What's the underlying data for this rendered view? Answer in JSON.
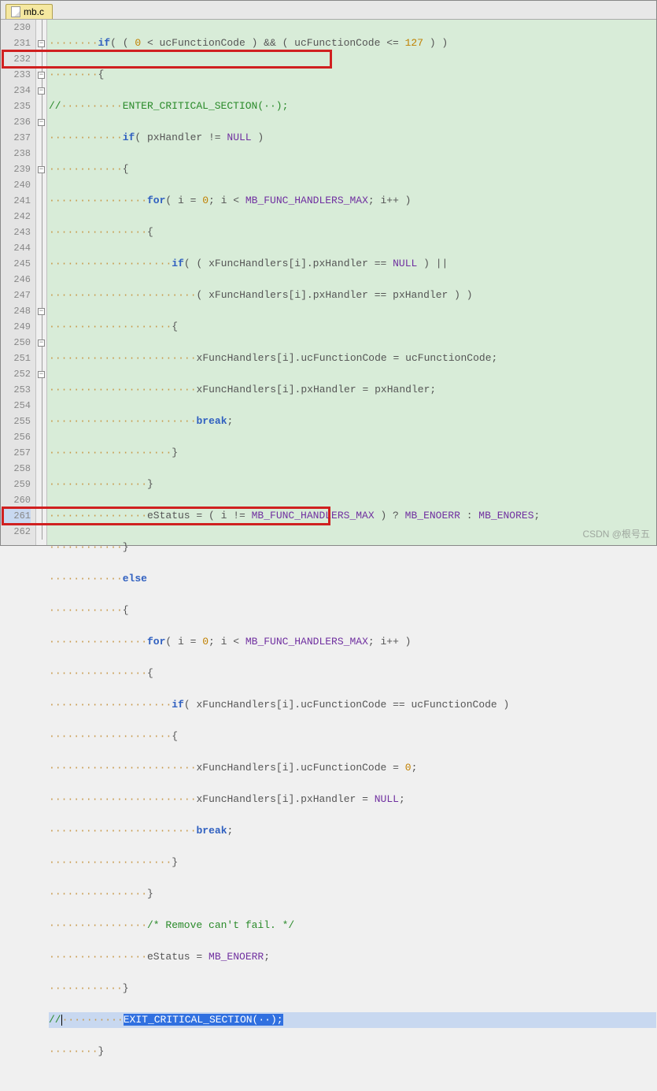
{
  "tab": {
    "filename": "mb.c"
  },
  "watermark": "CSDN @根号五",
  "fold": {
    "minus": "−",
    "rows": [
      {
        "n": 230,
        "t": "line"
      },
      {
        "n": 231,
        "t": "box"
      },
      {
        "n": 232,
        "t": "line"
      },
      {
        "n": 233,
        "t": "box"
      },
      {
        "n": 234,
        "t": "box"
      },
      {
        "n": 235,
        "t": "line"
      },
      {
        "n": 236,
        "t": "box"
      },
      {
        "n": 237,
        "t": "line"
      },
      {
        "n": 238,
        "t": "line"
      },
      {
        "n": 239,
        "t": "box"
      },
      {
        "n": 240,
        "t": "line"
      },
      {
        "n": 241,
        "t": "line"
      },
      {
        "n": 242,
        "t": "line"
      },
      {
        "n": 243,
        "t": "line"
      },
      {
        "n": 244,
        "t": "line"
      },
      {
        "n": 245,
        "t": "line"
      },
      {
        "n": 246,
        "t": "line"
      },
      {
        "n": 247,
        "t": "line"
      },
      {
        "n": 248,
        "t": "box"
      },
      {
        "n": 249,
        "t": "line"
      },
      {
        "n": 250,
        "t": "box"
      },
      {
        "n": 251,
        "t": "line"
      },
      {
        "n": 252,
        "t": "box"
      },
      {
        "n": 253,
        "t": "line"
      },
      {
        "n": 254,
        "t": "line"
      },
      {
        "n": 255,
        "t": "line"
      },
      {
        "n": 256,
        "t": "line"
      },
      {
        "n": 257,
        "t": "line"
      },
      {
        "n": 258,
        "t": "line"
      },
      {
        "n": 259,
        "t": "line"
      },
      {
        "n": 260,
        "t": "line"
      },
      {
        "n": 261,
        "t": "line"
      },
      {
        "n": 262,
        "t": "line"
      }
    ]
  },
  "code": {
    "l230": {
      "pre": "········",
      "kw": "if",
      "r1": "( ( ",
      "n1": "0",
      "r2": " < ucFunctionCode ) && ( ucFunctionCode <= ",
      "n2": "127",
      "r3": " ) )"
    },
    "l231": "········{",
    "l232": {
      "pre": "//",
      "ws": "··········",
      "txt": "ENTER_CRITICAL_SECTION(··);"
    },
    "l233": {
      "pre": "············",
      "kw": "if",
      "r1": "( pxHandler != ",
      "mac": "NULL",
      "r2": " )"
    },
    "l234": "············{",
    "l235": {
      "pre": "················",
      "kw": "for",
      "r1": "( i = ",
      "n1": "0",
      "r2": "; i < ",
      "mac": "MB_FUNC_HANDLERS_MAX",
      "r3": "; i++ )"
    },
    "l236": "················{",
    "l237": {
      "pre": "····················",
      "kw": "if",
      "r1": "( ( xFuncHandlers[i].pxHandler == ",
      "mac": "NULL",
      "r2": " ) ||"
    },
    "l238": {
      "pre": "························",
      "r1": "( xFuncHandlers[i].pxHandler == pxHandler ) )"
    },
    "l239": "····················{",
    "l240": "························xFuncHandlers[i].ucFunctionCode = ucFunctionCode;",
    "l241": "························xFuncHandlers[i].pxHandler = pxHandler;",
    "l242": {
      "pre": "························",
      "kw": "break",
      "r1": ";"
    },
    "l243": "····················}",
    "l244": "················}",
    "l245": {
      "pre": "················",
      "r1": "eStatus = ( i != ",
      "mac1": "MB_FUNC_HANDLERS_MAX",
      "r2": " ) ? ",
      "mac2": "MB_ENOERR",
      "r3": " : ",
      "mac3": "MB_ENORES",
      "r4": ";"
    },
    "l246": "············}",
    "l247": {
      "pre": "············",
      "kw": "else"
    },
    "l248": "············{",
    "l249": {
      "pre": "················",
      "kw": "for",
      "r1": "( i = ",
      "n1": "0",
      "r2": "; i < ",
      "mac": "MB_FUNC_HANDLERS_MAX",
      "r3": "; i++ )"
    },
    "l250": "················{",
    "l251": {
      "pre": "····················",
      "kw": "if",
      "r1": "( xFuncHandlers[i].ucFunctionCode == ucFunctionCode )"
    },
    "l252": "····················{",
    "l253": {
      "pre": "························",
      "r1": "xFuncHandlers[i].ucFunctionCode = ",
      "n1": "0",
      "r2": ";"
    },
    "l254": {
      "pre": "························",
      "r1": "xFuncHandlers[i].pxHandler = ",
      "mac": "NULL",
      "r2": ";"
    },
    "l255": {
      "pre": "························",
      "kw": "break",
      "r1": ";"
    },
    "l256": "····················}",
    "l257": "················}",
    "l258": {
      "pre": "················",
      "cm": "/* Remove can't fail. */"
    },
    "l259": {
      "pre": "················",
      "r1": "eStatus = ",
      "mac": "MB_ENOERR",
      "r2": ";"
    },
    "l260": "············}",
    "l261": {
      "pre": "//",
      "ws": "··········",
      "txt": "EXIT_CRITICAL_SECTION(··);"
    },
    "l262": "········}"
  }
}
